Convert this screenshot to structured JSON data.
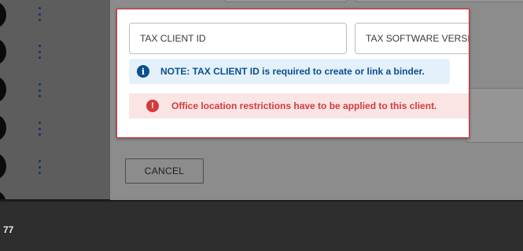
{
  "modal": {
    "fields": {
      "tax_client_id_placeholder": "TAX CLIENT ID",
      "tax_software_version_placeholder": "TAX SOFTWARE VERSION"
    },
    "note": {
      "icon": "info-icon",
      "text": "NOTE: TAX CLIENT ID is required to create or link a binder."
    },
    "error": {
      "icon": "error-icon",
      "text": "Office location restrictions have to be applied to this client."
    },
    "cancel_label": "CANCEL"
  },
  "footer": {
    "count": "77"
  },
  "colors": {
    "highlight_border": "#d9232d",
    "note_bg": "#e4f1fb",
    "note_text": "#0a4f8f",
    "error_bg": "#fbe4e4",
    "error_text": "#d23b3b"
  }
}
